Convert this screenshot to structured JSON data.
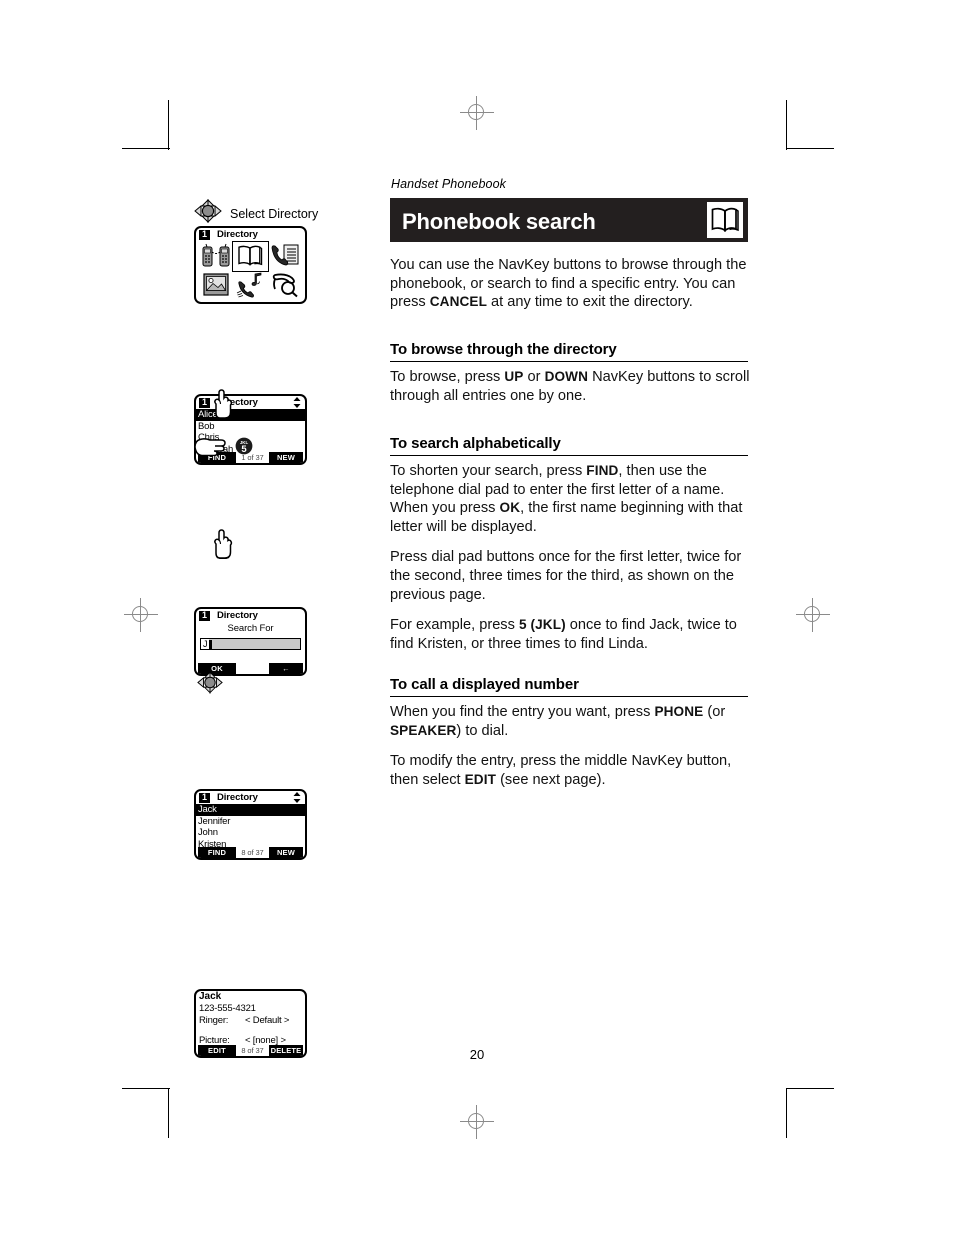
{
  "document": {
    "running_head": "Handset Phonebook",
    "page_number": "20"
  },
  "header": {
    "title": "Phonebook search",
    "icon": "open-book-icon"
  },
  "main": {
    "intro": {
      "part1": "You can use the NavKey buttons to browse through the phonebook, or search to find a specific entry. You can press ",
      "bold1": "CANCEL",
      "part2": " at any time to exit the directory."
    },
    "sections": [
      {
        "heading": "To browse through the directory",
        "paragraphs": [
          {
            "part1": "To browse, press ",
            "bold1": "UP",
            "part2": " or ",
            "bold2": "DOWN",
            "part3": " NavKey buttons to scroll through all entries one by one."
          }
        ]
      },
      {
        "heading": "To search alphabetically",
        "paragraphs": [
          {
            "part1": "To shorten your search, press ",
            "bold1": "FIND",
            "part2": ", then use the telephone dial pad to enter the first letter of a name. When you press ",
            "bold2": "OK",
            "part3": ", the first name beginning with that letter will be displayed."
          },
          {
            "part1": "Press dial pad buttons once for the first letter, twice for the second, three times for the third, as shown on the previous page."
          },
          {
            "part1": "For example, press ",
            "bold1": "5 (JKL)",
            "part2": " once to find Jack, twice to find Kristen, or three times to find Linda."
          }
        ]
      },
      {
        "heading": "To call a displayed number",
        "paragraphs": [
          {
            "part1": "When you find the entry you want, press ",
            "bold1": "PHONE",
            "part2": " (or ",
            "bold2": "SPEAKER",
            "part3": ") to dial."
          },
          {
            "part1": "To modify the entry, press the middle NavKey button, then select ",
            "bold1": "EDIT",
            "part2": " (see next page)."
          }
        ]
      }
    ]
  },
  "illustrations": {
    "step1": {
      "caption": "Select Directory",
      "nav_icon": "navkey-icon",
      "screen": {
        "slot": "1",
        "title": "Directory",
        "icons": [
          "two-handsets-intercom-icon",
          "open-book-directory-icon",
          "phone-with-list-icon",
          "picture-frame-icon",
          "phone-with-music-note-icon",
          "phone-with-magnifier-icon"
        ],
        "selected_icon": "open-book-directory-icon"
      }
    },
    "step2": {
      "screen": {
        "slot": "1",
        "title": "Directory",
        "scroll_icon": "up-down-arrows-icon",
        "entries": [
          "Alice",
          "Bob",
          "Chris",
          "Deborah"
        ],
        "selected_entry": "Alice",
        "softkey_left": "FIND",
        "counter": "1 of 37",
        "softkey_right": "NEW"
      },
      "hand_icon": "pointing-hand-up-icon"
    },
    "step3": {
      "hand_icon": "pointing-hand-right-icon",
      "key_icon": "dial-key-5",
      "key_label": "5",
      "key_letters": "JKL",
      "screen": {
        "slot": "1",
        "title": "Directory",
        "subtitle": "Search For",
        "input_value": "J",
        "softkey_left": "OK",
        "softkey_right": "←"
      },
      "hand_icon_2": "pointing-hand-up-icon"
    },
    "step4": {
      "screen": {
        "slot": "1",
        "title": "Directory",
        "scroll_icon": "up-down-arrows-icon",
        "entries": [
          "Jack",
          "Jennifer",
          "John",
          "Kristen"
        ],
        "selected_entry": "Jack",
        "softkey_left": "FIND",
        "counter": "8 of 37",
        "softkey_right": "NEW"
      }
    },
    "step5": {
      "nav_icon": "navkey-icon",
      "screen": {
        "name": "Jack",
        "number": "123-555-4321",
        "ringer_label": "Ringer:",
        "ringer_value": "< Default >",
        "picture_label": "Picture:",
        "picture_value": "< [none] >",
        "softkey_left": "EDIT",
        "counter": "8 of 37",
        "softkey_right": "DELETE"
      }
    }
  }
}
